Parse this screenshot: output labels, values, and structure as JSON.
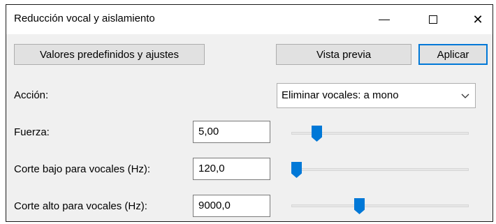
{
  "window": {
    "title": "Reducción vocal y aislamiento"
  },
  "titlebar_buttons": {
    "minimize": "minimize-icon",
    "maximize": "maximize-icon",
    "close": "close-icon",
    "close_glyph": "✕"
  },
  "toolbar": {
    "presets_label": "Valores predefinidos y ajustes",
    "preview_label": "Vista previa",
    "apply_label": "Aplicar"
  },
  "action": {
    "label": "Acción:",
    "selected": "Eliminar vocales: a mono"
  },
  "params": [
    {
      "label": "Fuerza:",
      "value": "5,00",
      "slider_fraction": 0.12
    },
    {
      "label": "Corte bajo para vocales (Hz):",
      "value": "120,0",
      "slider_fraction": 0.0
    },
    {
      "label": "Corte alto para vocales (Hz):",
      "value": "9000,0",
      "slider_fraction": 0.375
    }
  ],
  "colors": {
    "accent": "#0078d7"
  }
}
